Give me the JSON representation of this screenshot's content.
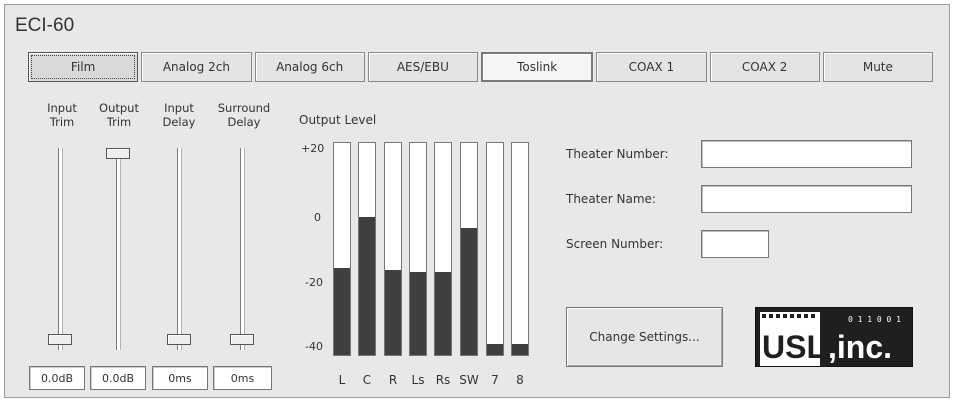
{
  "app": {
    "title": "ECI-60"
  },
  "tabs": [
    {
      "label": "Film",
      "state": "selected"
    },
    {
      "label": "Analog 2ch",
      "state": "normal"
    },
    {
      "label": "Analog 6ch",
      "state": "normal"
    },
    {
      "label": "AES/EBU",
      "state": "normal"
    },
    {
      "label": "Toslink",
      "state": "pressed"
    },
    {
      "label": "COAX 1",
      "state": "normal"
    },
    {
      "label": "COAX 2",
      "state": "normal"
    },
    {
      "label": "Mute",
      "state": "normal"
    }
  ],
  "controls": [
    {
      "label_line1": "Input",
      "label_line2": "Trim",
      "value": "0.0dB"
    },
    {
      "label_line1": "Output",
      "label_line2": "Trim",
      "value": "0.0dB"
    },
    {
      "label_line1": "Input",
      "label_line2": "Delay",
      "value": "0ms"
    },
    {
      "label_line1": "Surround",
      "label_line2": "Delay",
      "value": "0ms"
    }
  ],
  "output_level": {
    "title": "Output Level",
    "scale": [
      "+20",
      "0",
      "-20",
      "-40"
    ],
    "channels": [
      {
        "name": "L",
        "level": 0.41
      },
      {
        "name": "C",
        "level": 0.65
      },
      {
        "name": "R",
        "level": 0.4
      },
      {
        "name": "Ls",
        "level": 0.39
      },
      {
        "name": "Rs",
        "level": 0.39
      },
      {
        "name": "SW",
        "level": 0.6
      },
      {
        "name": "7",
        "level": 0.05
      },
      {
        "name": "8",
        "level": 0.05
      }
    ]
  },
  "theater": {
    "number_label": "Theater Number:",
    "number_value": "",
    "name_label": "Theater Name:",
    "name_value": "",
    "screen_label": "Screen Number:",
    "screen_value": ""
  },
  "change_settings_label": "Change Settings...",
  "logo": {
    "text": "USL,inc.",
    "digits": "0 1 1 0 0 1"
  },
  "colors": {
    "panel": "#e8e8e8",
    "meter_fill": "#3f3f3f",
    "logo_bg": "#222222"
  }
}
